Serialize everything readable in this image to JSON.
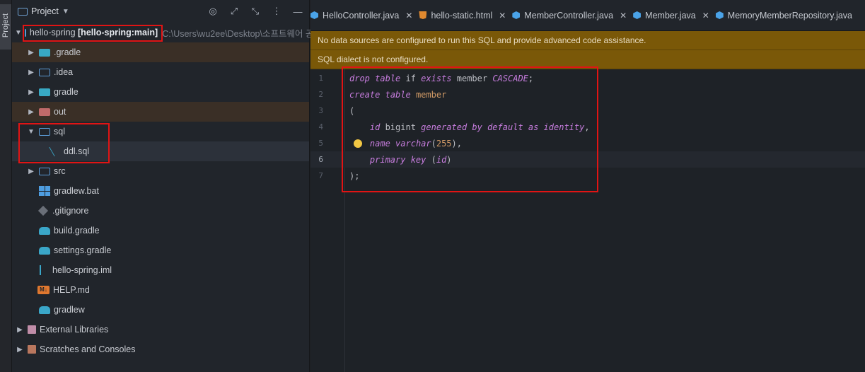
{
  "left_strip": {
    "tab_label": "Project"
  },
  "project_panel": {
    "title": "Project",
    "actions": [
      "target-icon",
      "expand-icon",
      "collapse-icon",
      "more-icon",
      "hide-icon"
    ],
    "tree": [
      {
        "label": "hello-spring",
        "bold": "[hello-spring:main]",
        "path": "C:\\Users\\wu2ee\\Desktop\\소프트웨어 공",
        "icon": "module-folder-icon"
      },
      {
        "label": ".gradle",
        "icon": "gradle-folder-icon"
      },
      {
        "label": ".idea",
        "icon": "idea-folder-icon"
      },
      {
        "label": "gradle",
        "icon": "gradle-folder-icon"
      },
      {
        "label": "out",
        "icon": "excluded-folder-icon"
      },
      {
        "label": "sql",
        "icon": "sql-folder-icon"
      },
      {
        "label": "ddl.sql",
        "icon": "sql-file-icon"
      },
      {
        "label": "src",
        "icon": "source-folder-icon"
      },
      {
        "label": "gradlew.bat",
        "icon": "windows-icon"
      },
      {
        "label": ".gitignore",
        "icon": "gitignore-icon"
      },
      {
        "label": "build.gradle",
        "icon": "gradle-icon"
      },
      {
        "label": "settings.gradle",
        "icon": "gradle-icon"
      },
      {
        "label": "hello-spring.iml",
        "icon": "iml-icon"
      },
      {
        "label": "HELP.md",
        "icon": "markdown-icon"
      },
      {
        "label": "gradlew",
        "icon": "gradle-icon"
      },
      {
        "label": "External Libraries",
        "icon": "library-icon"
      },
      {
        "label": "Scratches and Consoles",
        "icon": "scratches-icon"
      }
    ]
  },
  "editor": {
    "tabs": [
      {
        "label": "HelloController.java",
        "type": "java"
      },
      {
        "label": "hello-static.html",
        "type": "html"
      },
      {
        "label": "MemberController.java",
        "type": "java"
      },
      {
        "label": "Member.java",
        "type": "java"
      },
      {
        "label": "MemoryMemberRepository.java",
        "type": "java"
      }
    ],
    "banners": [
      "No data sources are configured to run this SQL and provide advanced code assistance.",
      "SQL dialect is not configured."
    ],
    "current_line": 6,
    "lines": [
      {
        "n": "1",
        "tokens": [
          {
            "t": "drop",
            "c": "kw"
          },
          {
            "t": " "
          },
          {
            "t": "table",
            "c": "kw"
          },
          {
            "t": " if "
          },
          {
            "t": "exists",
            "c": "kw"
          },
          {
            "t": " member "
          },
          {
            "t": "CASCADE",
            "c": "kw"
          },
          {
            "t": ";"
          }
        ]
      },
      {
        "n": "2",
        "tokens": [
          {
            "t": "create",
            "c": "kw"
          },
          {
            "t": " "
          },
          {
            "t": "table",
            "c": "kw"
          },
          {
            "t": " "
          },
          {
            "t": "member",
            "c": "tb"
          }
        ]
      },
      {
        "n": "3",
        "tokens": [
          {
            "t": "("
          }
        ]
      },
      {
        "n": "4",
        "tokens": [
          {
            "t": "    "
          },
          {
            "t": "id",
            "c": "kw"
          },
          {
            "t": " bigint "
          },
          {
            "t": "generated by default as identity",
            "c": "kw"
          },
          {
            "t": ","
          }
        ]
      },
      {
        "n": "5",
        "tokens": [
          {
            "t": "    "
          },
          {
            "t": "name",
            "c": "kw"
          },
          {
            "t": " "
          },
          {
            "t": "varchar",
            "c": "kw"
          },
          {
            "t": "("
          },
          {
            "t": "255",
            "c": "num"
          },
          {
            "t": "),"
          }
        ]
      },
      {
        "n": "6",
        "tokens": [
          {
            "t": "    "
          },
          {
            "t": "primary key",
            "c": "kw"
          },
          {
            "t": " ("
          },
          {
            "t": "id",
            "c": "kw"
          },
          {
            "t": ")"
          }
        ]
      },
      {
        "n": "7",
        "tokens": [
          {
            "t": ");"
          }
        ]
      }
    ]
  },
  "colors": {
    "highlight": "#e11414",
    "banner": "#7a5808",
    "keyword": "#c77dde"
  }
}
